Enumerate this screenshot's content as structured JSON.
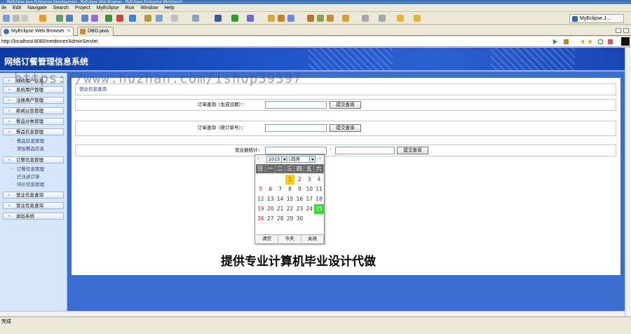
{
  "window": {
    "title": "MyEclipse Java Enterprise Development - MyEclipse Web Browser - MyEclipse Enterprise Workbench"
  },
  "menu": [
    "ile",
    "Edit",
    "Navigate",
    "Search",
    "Project",
    "MyEclipse",
    "Run",
    "Window",
    "Help"
  ],
  "perspective": {
    "label": "MyEclipse J..."
  },
  "tabs": [
    {
      "label": "MyEclipse Web Browser",
      "icon": "globe-icon"
    },
    {
      "label": "DBO.java",
      "icon": "java-file-icon"
    }
  ],
  "address": {
    "url": "http://localhost:8080/netdinner/AdminServlet"
  },
  "site": {
    "title": "网络订餐管理信息系统"
  },
  "sidebar": {
    "items": [
      {
        "label": "修改用户信息"
      },
      {
        "label": "系统用户管理"
      },
      {
        "label": "注册用户管理"
      },
      {
        "label": "新闻公告管理"
      },
      {
        "label": "餐品分类管理"
      },
      {
        "label": "餐品信息管理"
      },
      {
        "label": "订餐信息管理"
      },
      {
        "label": "营业信息查询"
      },
      {
        "label": "营业信息查询"
      },
      {
        "label": "退出系统"
      }
    ],
    "subs": {
      "food": [
        "餐品信息管理",
        "添加餐品信息"
      ],
      "order": [
        "订餐信息管理",
        "已派送订单",
        "评价信息管理"
      ]
    }
  },
  "main": {
    "section_title": "营业信息查询",
    "query_date_label": "订单查询（生成日期）：",
    "query_no_label": "订单查询（按订单号）：",
    "stats_label": "营业额统计：",
    "range_sep": "-",
    "submit_label": "提交查询",
    "submit2_label": "提交查询",
    "submit3_label": "提交查询"
  },
  "calendar": {
    "year": "2015",
    "month": "四月",
    "weekdays": [
      "日",
      "一",
      "二",
      "三",
      "四",
      "五",
      "六"
    ],
    "days": [
      [
        "",
        "",
        "",
        "1",
        "2",
        "3",
        "4"
      ],
      [
        "5",
        "6",
        "7",
        "8",
        "9",
        "10",
        "11"
      ],
      [
        "12",
        "13",
        "14",
        "15",
        "16",
        "17",
        "18"
      ],
      [
        "19",
        "20",
        "21",
        "22",
        "23",
        "24",
        "25"
      ],
      [
        "26",
        "27",
        "28",
        "29",
        "30",
        "",
        ""
      ]
    ],
    "today": "1",
    "selected": "25",
    "clear_label": "清空",
    "today_label": "今天",
    "close_label": "关闭"
  },
  "overlay": {
    "text": "提供专业计算机毕业设计代做"
  },
  "watermark": {
    "text": "https://www.huzhan.com/ishop39397"
  },
  "status": {
    "text": "完成"
  }
}
